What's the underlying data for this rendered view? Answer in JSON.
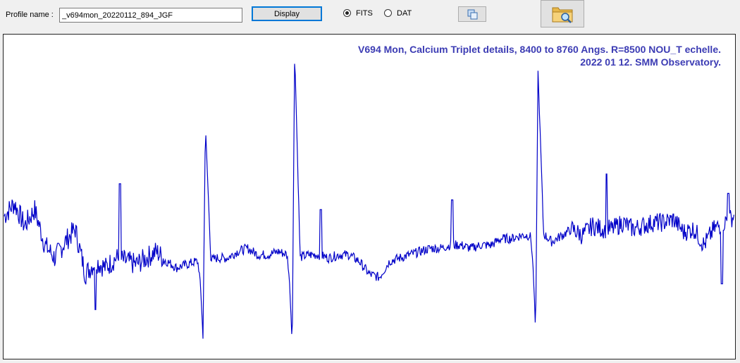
{
  "toolbar": {
    "profile_label": "Profile name :",
    "profile_value": "_v694mon_20220112_894_JGF",
    "display_label": "Display",
    "format_options": [
      {
        "label": "FITS",
        "selected": true
      },
      {
        "label": "DAT",
        "selected": false
      }
    ],
    "copy_icon": "copy-icon",
    "open_icon": "folder-search-icon"
  },
  "plot": {
    "title_line1": "V694 Mon, Calcium Triplet details, 8400 to 8760 Angs. R=8500 NOU_T echelle.",
    "title_line2": "2022 01 12. SMM Observatory.",
    "line_color": "#0000c8",
    "title_color": "#3c3cb4"
  },
  "chart_data": {
    "type": "line",
    "title": "V694 Mon, Calcium Triplet details, 8400 to 8760 Angs. R=8500 NOU_T echelle. 2022 01 12. SMM Observatory.",
    "xlabel": "",
    "ylabel": "",
    "xlim": [
      8400,
      8760
    ],
    "ylim": [
      0,
      1
    ],
    "grid": false,
    "series": [
      {
        "x": [
          8400,
          8405,
          8410,
          8415,
          8420,
          8425,
          8430,
          8435,
          8440,
          8445,
          8450,
          8455,
          8460,
          8465,
          8470,
          8475,
          8480,
          8485,
          8490,
          8495,
          8500,
          8505,
          8510,
          8515,
          8520,
          8525,
          8530,
          8535,
          8540,
          8545,
          8550,
          8555,
          8560,
          8565,
          8570,
          8575,
          8580,
          8585,
          8590,
          8595,
          8600,
          8605,
          8610,
          8615,
          8620,
          8625,
          8630,
          8635,
          8640,
          8645,
          8650,
          8655,
          8660,
          8665,
          8670,
          8675,
          8680,
          8685,
          8690,
          8695,
          8700,
          8705,
          8710,
          8715,
          8720,
          8725,
          8730,
          8735,
          8740,
          8745,
          8750,
          8755,
          8760
        ],
        "y": [
          0.44,
          0.48,
          0.41,
          0.46,
          0.35,
          0.31,
          0.36,
          0.4,
          0.26,
          0.3,
          0.28,
          0.31,
          0.3,
          0.29,
          0.31,
          0.33,
          0.3,
          0.28,
          0.29,
          0.3,
          0.3,
          0.31,
          0.31,
          0.33,
          0.34,
          0.32,
          0.32,
          0.33,
          0.32,
          0.31,
          0.32,
          0.32,
          0.31,
          0.32,
          0.32,
          0.3,
          0.26,
          0.25,
          0.3,
          0.31,
          0.32,
          0.33,
          0.34,
          0.34,
          0.35,
          0.35,
          0.34,
          0.35,
          0.35,
          0.37,
          0.37,
          0.38,
          0.38,
          0.39,
          0.36,
          0.38,
          0.4,
          0.38,
          0.41,
          0.4,
          0.4,
          0.42,
          0.4,
          0.41,
          0.42,
          0.42,
          0.43,
          0.39,
          0.4,
          0.35,
          0.4,
          0.42,
          0.44
        ]
      }
    ],
    "features": [
      {
        "x": 8498,
        "peak": 0.72,
        "trough": 0.06
      },
      {
        "x": 8542,
        "peak": 0.95,
        "trough": 0.03
      },
      {
        "x": 8662,
        "peak": 0.89,
        "trough": 0.07
      }
    ],
    "spikes": [
      {
        "x": 8457,
        "y": 0.54
      },
      {
        "x": 8556,
        "y": 0.46
      },
      {
        "x": 8621,
        "y": 0.49
      },
      {
        "x": 8697,
        "y": 0.57
      },
      {
        "x": 8757,
        "y": 0.51
      }
    ],
    "dips": [
      {
        "x": 8445,
        "y": 0.15
      },
      {
        "x": 8754,
        "y": 0.23
      }
    ]
  }
}
